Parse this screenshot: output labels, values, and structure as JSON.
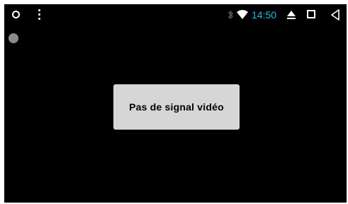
{
  "status_bar": {
    "clock": "14:50",
    "clock_color": "#33b5e5",
    "icons": [
      "home-icon",
      "menu-dots-icon",
      "bluetooth-icon",
      "wifi-icon",
      "eject-icon",
      "recents-icon",
      "back-icon"
    ]
  },
  "dialog": {
    "message": "Pas de signal vidéo"
  },
  "colors": {
    "background": "#000000",
    "dialog_bg": "#d6d6d6"
  }
}
